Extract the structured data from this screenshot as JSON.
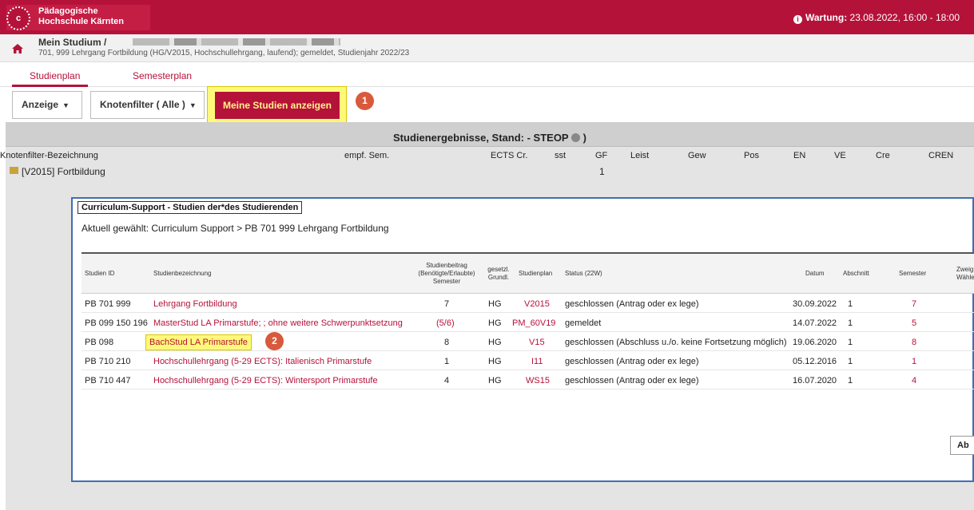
{
  "header": {
    "logo_line1": "Pädagogische",
    "logo_line2": "Hochschule Kärnten",
    "logo_glyph": "c",
    "maintenance_label": "Wartung:",
    "maintenance_time": "23.08.2022, 16:00 - 18:00"
  },
  "breadcrumb": {
    "title": "Mein Studium /",
    "subtitle": "701, 999 Lehrgang Fortbildung (HG/V2015, Hochschullehrgang, laufend); gemeldet, Studienjahr 2022/23"
  },
  "tabs": [
    {
      "label": "Studienplan"
    },
    {
      "label": "Semesterplan"
    }
  ],
  "toolbar": {
    "display_label": "Anzeige",
    "filter_label": "Knotenfilter ( Alle )",
    "my_studies_label": "Meine Studien anzeigen",
    "marker1": "1",
    "marker2": "2"
  },
  "results": {
    "title_prefix": "Studienergebnisse, Stand: - STEOP",
    "title_suffix": ")",
    "columns": {
      "name": "Knotenfilter-Bezeichnung",
      "sem": "empf. Sem.",
      "ects": "ECTS Cr.",
      "sst": "sst",
      "gf": "GF",
      "leist": "Leist",
      "gew": "Gew",
      "pos": "Pos",
      "en": "EN",
      "ve": "VE",
      "cre": "Cre",
      "cren": "CREN"
    },
    "row_name": "[V2015] Fortbildung",
    "row_gf": "1"
  },
  "dialog": {
    "title": "Curriculum-Support - Studien der*des Studierenden",
    "path": "Aktuell gewählt: Curriculum Support > PB 701 999 Lehrgang Fortbildung",
    "headers": {
      "id": "Studien ID",
      "name": "Studienbezeichnung",
      "beitrag_1": "Studienbeitrag",
      "beitrag_2": "(Benötigte/Erlaubte)",
      "beitrag_3": "Semester",
      "grundl_1": "gesetzl.",
      "grundl_2": "Grundl.",
      "plan": "Studienplan",
      "status": "Status (22W)",
      "datum": "Datum",
      "abschnitt": "Abschnitt",
      "semester": "Semester",
      "zweig_1": "Zweig",
      "zweig_2": "Wähle"
    },
    "rows": [
      {
        "id": "PB 701 999",
        "name": "Lehrgang Fortbildung",
        "beitrag": "7",
        "grundl": "HG",
        "plan": "V2015",
        "status": "geschlossen (Antrag oder ex lege)",
        "datum": "30.09.2022",
        "abschnitt": "1",
        "semester": "7"
      },
      {
        "id": "PB 099 150 196",
        "name": "MasterStud LA Primarstufe; ; ohne weitere Schwerpunktsetzung",
        "beitrag": "(5/6)",
        "grundl": "HG",
        "plan": "PM_60V19",
        "status": "gemeldet",
        "datum": "14.07.2022",
        "abschnitt": "1",
        "semester": "5"
      },
      {
        "id": "PB 098",
        "name": "BachStud LA Primarstufe",
        "beitrag": "8",
        "grundl": "HG",
        "plan": "V15",
        "status": "geschlossen (Abschluss u./o. keine Fortsetzung möglich)",
        "datum": "19.06.2020",
        "abschnitt": "1",
        "semester": "8"
      },
      {
        "id": "PB 710 210",
        "name": "Hochschullehrgang (5-29 ECTS): Italienisch Primarstufe",
        "beitrag": "1",
        "grundl": "HG",
        "plan": "I11",
        "status": "geschlossen (Antrag oder ex lege)",
        "datum": "05.12.2016",
        "abschnitt": "1",
        "semester": "1"
      },
      {
        "id": "PB 710 447",
        "name": "Hochschullehrgang (5-29 ECTS): Wintersport Primarstufe",
        "beitrag": "4",
        "grundl": "HG",
        "plan": "WS15",
        "status": "geschlossen (Antrag oder ex lege)",
        "datum": "16.07.2020",
        "abschnitt": "1",
        "semester": "4"
      }
    ],
    "abort_label": "Ab"
  },
  "colors": {
    "brand": "#b5123a",
    "highlight": "#fff97a",
    "dialog_border": "#3f6fb5",
    "marker": "#d9593c"
  }
}
